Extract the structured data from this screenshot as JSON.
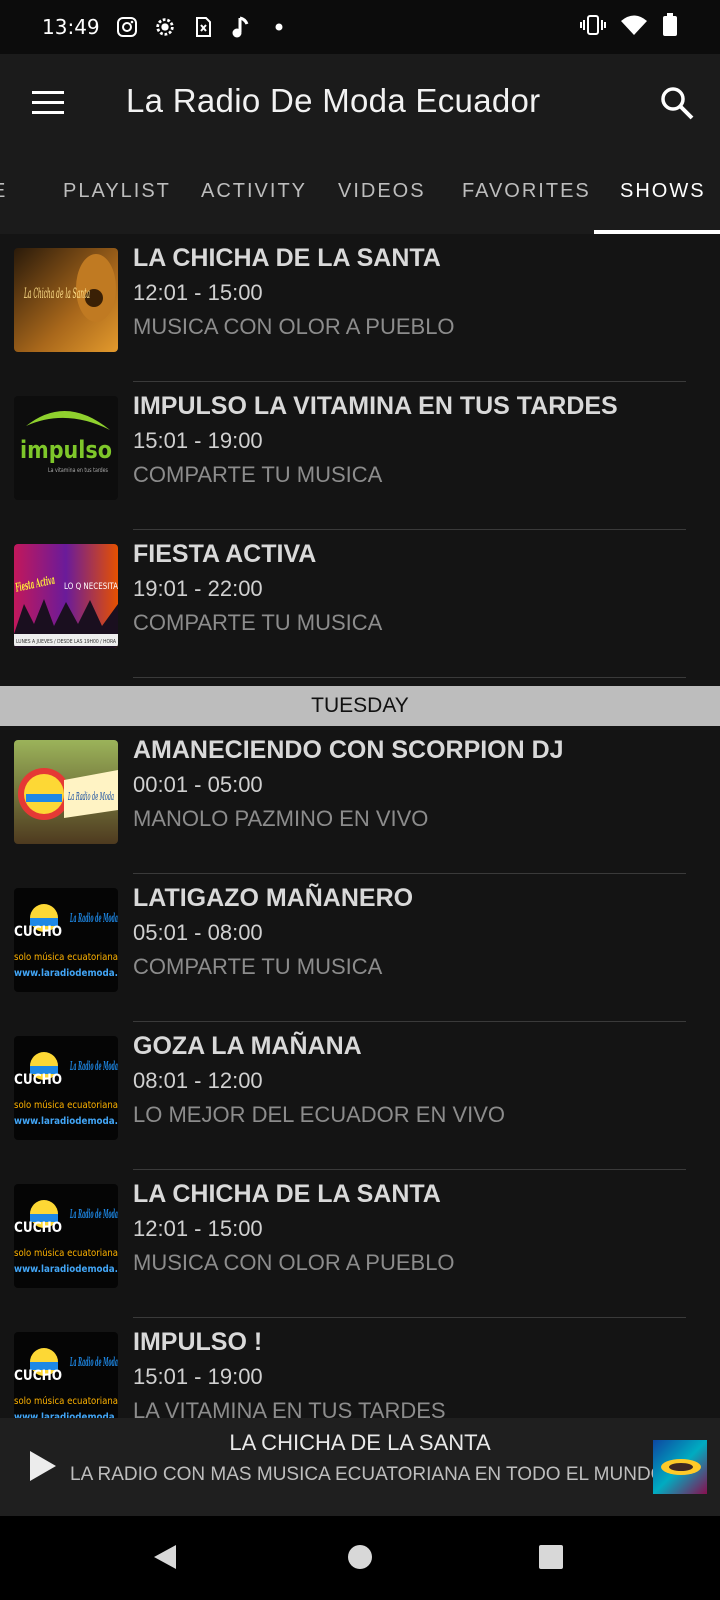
{
  "status_bar": {
    "time": "13:49",
    "left_icons": [
      "instagram-icon",
      "settings-icon",
      "sim-icon",
      "music-note-icon",
      "dot-icon"
    ],
    "right_icons": [
      "vibrate-icon",
      "wifi-icon",
      "battery-icon"
    ]
  },
  "app_bar": {
    "title": "La Radio De Moda Ecuador"
  },
  "tabs": [
    {
      "label": "E"
    },
    {
      "label": "PLAYLIST"
    },
    {
      "label": "ACTIVITY"
    },
    {
      "label": "VIDEOS"
    },
    {
      "label": "FAVORITES"
    },
    {
      "label": "SHOWS",
      "active": true
    }
  ],
  "shows_before_header": [
    {
      "name": "LA CHICHA DE LA SANTA",
      "time": "12:01 - 15:00",
      "desc": "MUSICA CON OLOR A PUEBLO",
      "thumb": "chicha-santa"
    },
    {
      "name": "IMPULSO LA VITAMINA EN TUS TARDES",
      "time": "15:01 - 19:00",
      "desc": "COMPARTE TU MUSICA",
      "thumb": "impulso"
    },
    {
      "name": "FIESTA ACTIVA",
      "time": "19:01 - 22:00",
      "desc": "COMPARTE TU MUSICA",
      "thumb": "fiesta-activa"
    }
  ],
  "day_header": "TUESDAY",
  "shows_after_header": [
    {
      "name": "AMANECIENDO CON SCORPION DJ",
      "time": "00:01 - 05:00",
      "desc": "MANOLO PAZMINO EN VIVO",
      "thumb": "amaneciendo"
    },
    {
      "name": "LATIGAZO MAÑANERO",
      "time": "05:01 - 08:00",
      "desc": "COMPARTE TU MUSICA",
      "thumb": "radio-moda"
    },
    {
      "name": "GOZA LA MAÑANA",
      "time": "08:01 - 12:00",
      "desc": "LO MEJOR DEL ECUADOR EN VIVO",
      "thumb": "radio-moda"
    },
    {
      "name": "LA CHICHA DE LA SANTA",
      "time": "12:01 - 15:00",
      "desc": "MUSICA CON OLOR A PUEBLO",
      "thumb": "radio-moda"
    },
    {
      "name": "IMPULSO !",
      "time": "15:01 - 19:00",
      "desc": "LA VITAMINA EN TUS TARDES",
      "thumb": "radio-moda"
    }
  ],
  "thumb_text": {
    "chicha": "La Chicha de la Santa",
    "impulso": "impulso",
    "impulso_sub": "La vitamina en tus tardes",
    "fiesta": "Fiesta Activa",
    "fiesta_banner": "LO Q NECESITA",
    "fiesta_strip": "LUNES A JUEVES / DESDE LAS 19H00 / HORA",
    "moda_brand": "La Radio de Moda",
    "moda_cucho": "CUCHO",
    "moda_line": "solo música ecuatoriana",
    "moda_url": "www.laradiodemoda."
  },
  "player": {
    "title": "LA CHICHA DE LA SANTA",
    "subtitle": "LA RADIO CON MAS MUSICA ECUATORIANA EN TODO EL MUNDO"
  },
  "nav_bar": [
    "back-icon",
    "home-icon",
    "recents-icon"
  ],
  "colors": {
    "background": "#141414",
    "app_bar": "#1b1b1b",
    "day_header": "#bdbdbd",
    "tab_active": "#ffffff"
  }
}
